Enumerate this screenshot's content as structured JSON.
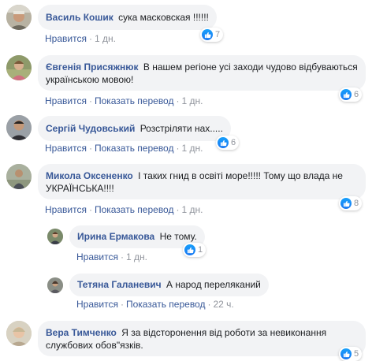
{
  "common": {
    "like": "Нравится",
    "translate": "Показать перевод",
    "dot": "·"
  },
  "comments": [
    {
      "author": "Василь Кошик",
      "text": "сука масковская !!!!!!",
      "time": "1 дн.",
      "reactions": "7"
    },
    {
      "author": "Євгенія Присяжнюк",
      "text": "В нашем регіоне усі заходи чудово відбуваються українською мовою!",
      "time": "1 дн.",
      "reactions": "6"
    },
    {
      "author": "Сергій Чудовський",
      "text": "Розстріляти нах.....",
      "time": "1 дн.",
      "reactions": "6"
    },
    {
      "author": "Микола Оксененко",
      "text": "І таких гнид в освіті море!!!!! Тому що влада не УКРАЇНСЬКА!!!!",
      "time": "1 дн.",
      "reactions": "8"
    },
    {
      "author": "Ирина Ермакова",
      "text": "Не тому.",
      "time": "1 дн.",
      "reactions": "1"
    },
    {
      "author": "Тетяна Галаневич",
      "text": "А народ переляканий",
      "time": "22 ч."
    },
    {
      "author": "Вера Тимченко",
      "text": "Я за відсторонення від роботи за невиконання службових обов\"язків.",
      "reactions": "5"
    }
  ],
  "colors": {
    "author": "#385898",
    "bubble": "#f2f3f5",
    "like": "#1877f2",
    "meta": "#90949c"
  }
}
